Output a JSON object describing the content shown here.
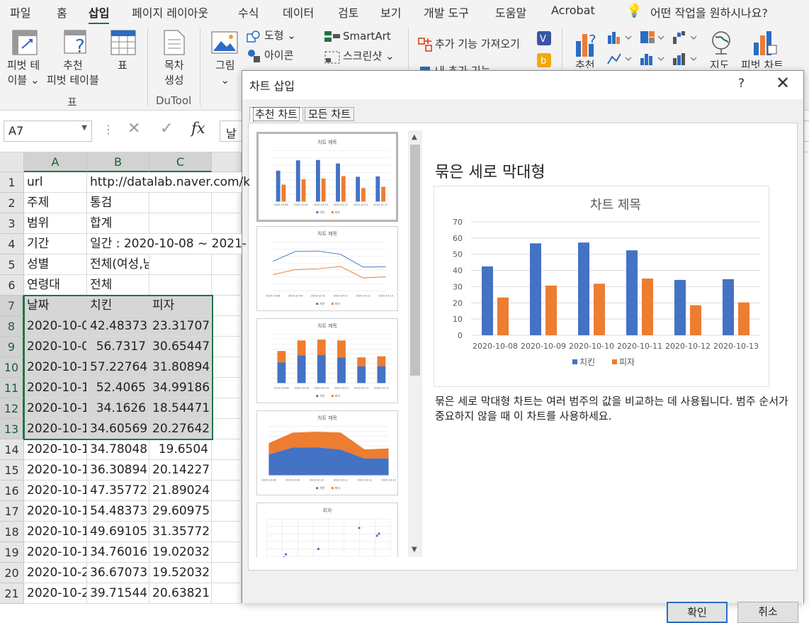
{
  "menu": [
    "파일",
    "홈",
    "삽입",
    "페이지 레이아웃",
    "수식",
    "데이터",
    "검토",
    "보기",
    "개발 도구",
    "도움말",
    "Acrobat",
    "어떤 작업을 원하시나요?"
  ],
  "ribbon": {
    "pivot_table": [
      "피벗 테",
      "이블 ⌄"
    ],
    "recommended_pivot": [
      "추천",
      "피벗 테이블"
    ],
    "table": "표",
    "group_table": "표",
    "toc": [
      "목차",
      "생성"
    ],
    "group_dutool": "DuTool",
    "picture": [
      "그림",
      "⌄"
    ],
    "shapes": "도형 ⌄",
    "icons": "아이콘",
    "smartart": "SmartArt",
    "screenshot": "스크린샷 ⌄",
    "addins": "추가 기능 가져오기",
    "my_addins": "내 추가 기능",
    "recommended_charts": "추천",
    "maps": "지도",
    "pivot_chart": "피벗 차트"
  },
  "formula_bar": {
    "name_box": "A7",
    "content": "날"
  },
  "columns": [
    "A",
    "B",
    "C"
  ],
  "rows": [
    {
      "n": "1",
      "a": "url",
      "b": "http://datalab.naver.com/k",
      "c": ""
    },
    {
      "n": "2",
      "a": "주제",
      "b": "통검",
      "c": ""
    },
    {
      "n": "3",
      "a": "범위",
      "b": "합계",
      "c": ""
    },
    {
      "n": "4",
      "a": "기간",
      "b": "일간 : 2020-10-08 ~ 2021-",
      "c": ""
    },
    {
      "n": "5",
      "a": "성별",
      "b": "전체(여성,남성)",
      "c": ""
    },
    {
      "n": "6",
      "a": "연령대",
      "b": "전체",
      "c": ""
    },
    {
      "n": "7",
      "a": "날짜",
      "b": "치킨",
      "c": "피자"
    },
    {
      "n": "8",
      "a": "2020-10-0",
      "b": "42.48373",
      "c": "23.31707"
    },
    {
      "n": "9",
      "a": "2020-10-0",
      "b": "56.7317",
      "c": "30.65447"
    },
    {
      "n": "10",
      "a": "2020-10-1",
      "b": "57.22764",
      "c": "31.80894"
    },
    {
      "n": "11",
      "a": "2020-10-1",
      "b": "52.4065",
      "c": "34.99186"
    },
    {
      "n": "12",
      "a": "2020-10-1",
      "b": "34.1626",
      "c": "18.54471"
    },
    {
      "n": "13",
      "a": "2020-10-1",
      "b": "34.60569",
      "c": "20.27642"
    },
    {
      "n": "14",
      "a": "2020-10-1",
      "b": "34.78048",
      "c": "19.6504"
    },
    {
      "n": "15",
      "a": "2020-10-1",
      "b": "36.30894",
      "c": "20.14227"
    },
    {
      "n": "16",
      "a": "2020-10-1",
      "b": "47.35772",
      "c": "21.89024"
    },
    {
      "n": "17",
      "a": "2020-10-1",
      "b": "54.48373",
      "c": "29.60975"
    },
    {
      "n": "18",
      "a": "2020-10-1",
      "b": "49.69105",
      "c": "31.35772"
    },
    {
      "n": "19",
      "a": "2020-10-1",
      "b": "34.76016",
      "c": "19.02032"
    },
    {
      "n": "20",
      "a": "2020-10-2",
      "b": "36.67073",
      "c": "19.52032"
    },
    {
      "n": "21",
      "a": "2020-10-2",
      "b": "39.71544",
      "c": "20.63821"
    }
  ],
  "dialog": {
    "title": "차트 삽입",
    "help": "?",
    "close": "✕",
    "tabs": [
      "추천 차트",
      "모든 차트"
    ],
    "preview_heading": "묶은 세로 막대형",
    "description": "묶은 세로 막대형 차트는 여러 범주의 값을 비교하는 데 사용됩니다. 범주 순서가 중요하지 않을 때 이 차트를 사용하세요.",
    "ok": "확인",
    "cancel": "취소"
  },
  "thumb_titles": [
    "차트 제목",
    "차트 제목",
    "차트 제목",
    "차트 제목",
    "피자"
  ],
  "colors": {
    "series1": "#4472c4",
    "series2": "#ed7d31",
    "excel_green": "#217346"
  },
  "chart_data": {
    "type": "bar",
    "title": "차트 제목",
    "categories": [
      "2020-10-08",
      "2020-10-09",
      "2020-10-10",
      "2020-10-11",
      "2020-10-12",
      "2020-10-13"
    ],
    "series": [
      {
        "name": "치킨",
        "values": [
          42.48373,
          56.7317,
          57.22764,
          52.4065,
          34.1626,
          34.60569
        ]
      },
      {
        "name": "피자",
        "values": [
          23.31707,
          30.65447,
          31.80894,
          34.99186,
          18.54471,
          20.27642
        ]
      }
    ],
    "ylim": [
      0,
      70
    ],
    "yticks": [
      0,
      10,
      20,
      30,
      40,
      50,
      60,
      70
    ],
    "legend": "bottom",
    "grid": true
  }
}
